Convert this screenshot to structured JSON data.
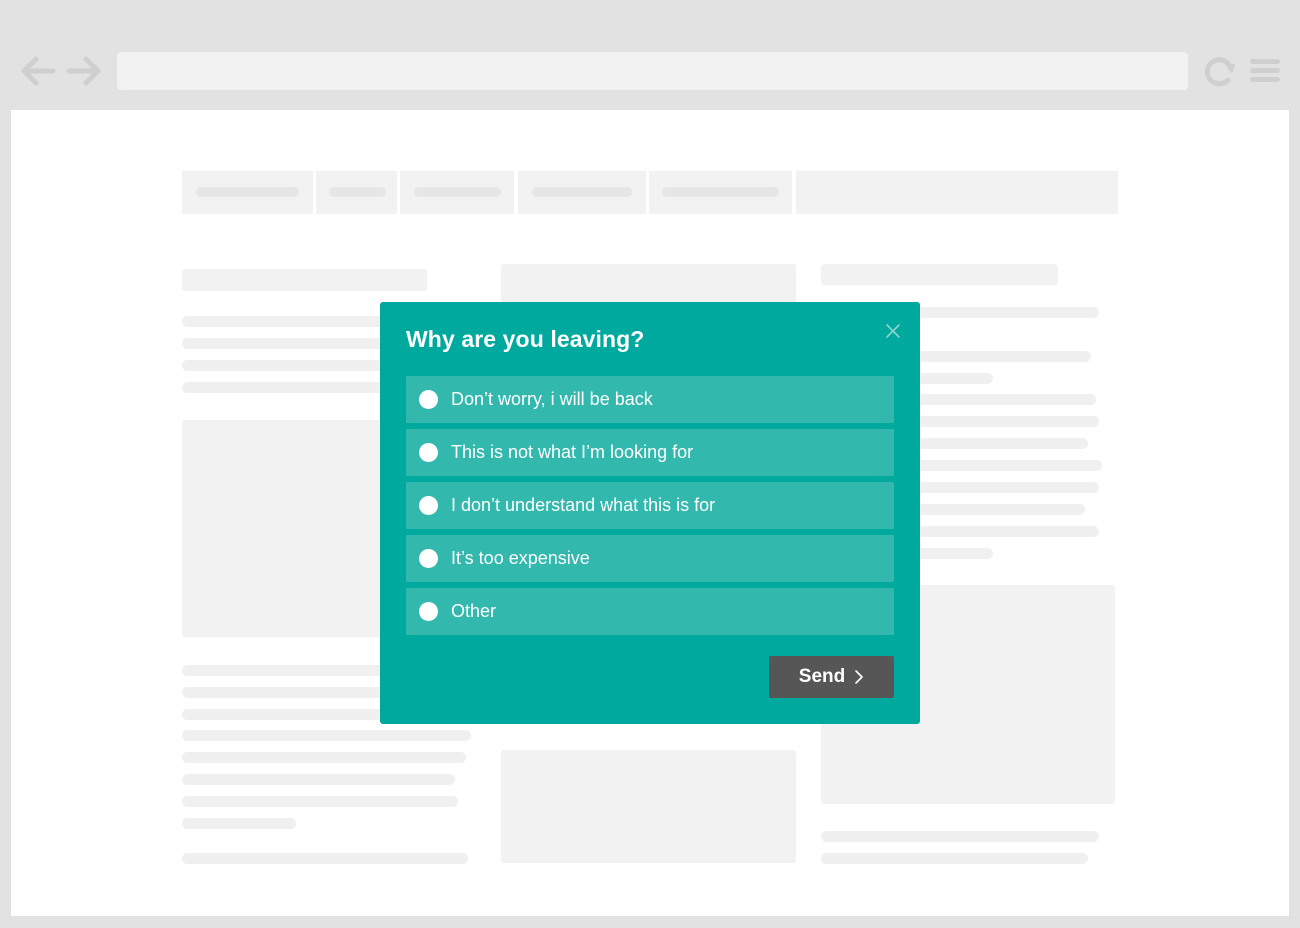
{
  "browser": {
    "address_value": "",
    "icons": {
      "back": "arrow-left-icon",
      "forward": "arrow-right-icon",
      "reload": "reload-icon",
      "menu": "hamburger-menu-icon"
    }
  },
  "modal": {
    "title": "Why are you leaving?",
    "options": [
      {
        "label": "Don’t worry, i will be back"
      },
      {
        "label": "This is not what I’m looking for"
      },
      {
        "label": "I don’t understand what this is for"
      },
      {
        "label": "It’s too expensive"
      },
      {
        "label": "Other"
      }
    ],
    "send_label": "Send",
    "close_icon": "close-icon",
    "send_icon": "chevron-right-icon"
  },
  "colors": {
    "modal_background": "#00a99d",
    "option_background": "#33b8ae",
    "send_button": "#565656",
    "chrome": "#e2e2e2",
    "skeleton": "#f2f2f2"
  }
}
